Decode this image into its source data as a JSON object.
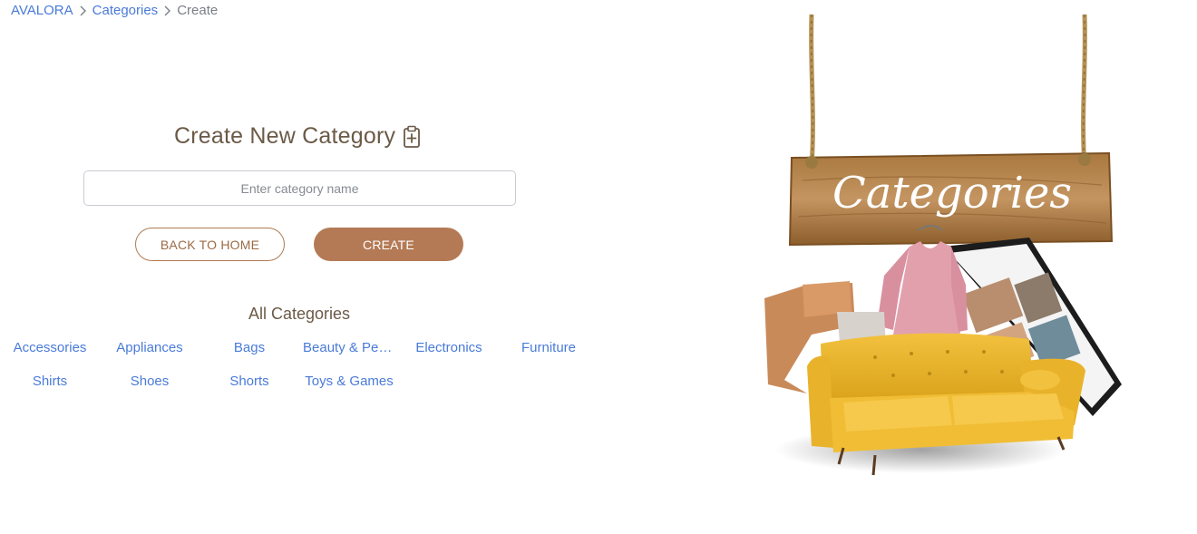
{
  "breadcrumb": {
    "items": [
      {
        "label": "AVALORA"
      },
      {
        "label": "Categories"
      }
    ],
    "current": "Create"
  },
  "form": {
    "title": "Create New Category",
    "title_icon": "clipboard-plus-icon",
    "input": {
      "placeholder": "Enter category name",
      "value": ""
    },
    "back_label": "BACK TO HOME",
    "create_label": "CREATE"
  },
  "categories": {
    "title": "All Categories",
    "items": [
      "Accessories",
      "Appliances",
      "Bags",
      "Beauty & Personal Care",
      "Electronics",
      "Furniture",
      "Shirts",
      "Shoes",
      "Shorts",
      "Toys & Games"
    ]
  },
  "banner": {
    "sign_text": "Categories"
  },
  "colors": {
    "link": "#4a7bd8",
    "accent": "#b47a55",
    "heading": "#6b5a47"
  }
}
